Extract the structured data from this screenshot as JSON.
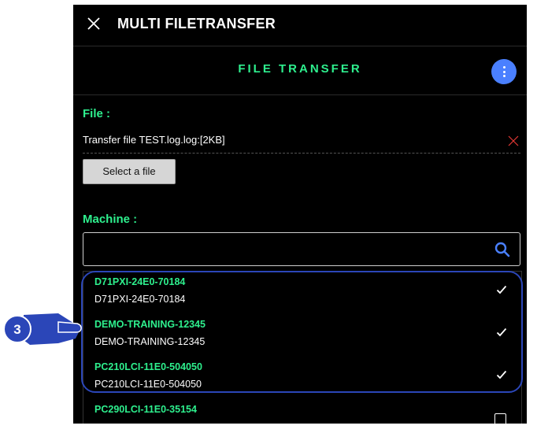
{
  "header": {
    "title": "MULTI FILETRANSFER"
  },
  "subheader": {
    "title": "FILE TRANSFER"
  },
  "file_section": {
    "label": "File :",
    "selected_file": "Transfer file TEST.log.log:[2KB]",
    "select_button_label": "Select a file"
  },
  "machine_section": {
    "label": "Machine :",
    "search_placeholder": "",
    "search_value": "",
    "items": [
      {
        "name": "D71PXI-24E0-70184",
        "subtitle": "D71PXI-24E0-70184",
        "checked": true
      },
      {
        "name": "DEMO-TRAINING-12345",
        "subtitle": "DEMO-TRAINING-12345",
        "checked": true
      },
      {
        "name": "PC210LCI-11E0-504050",
        "subtitle": "PC210LCI-11E0-504050",
        "checked": true
      },
      {
        "name": "PC290LCI-11E0-35154",
        "subtitle": "",
        "checked": false
      }
    ]
  },
  "annotation": {
    "step_number": "3"
  },
  "colors": {
    "accent_green": "#2ef08e",
    "menu_blue": "#4a80ff",
    "highlight_blue": "#2b46b8",
    "remove_red": "#e53935",
    "background": "#000000"
  },
  "icons": {
    "close": "close-icon",
    "menu": "kebab-menu-icon",
    "remove": "remove-icon",
    "search": "search-icon",
    "check": "check-icon",
    "pointer": "pointing-hand-icon"
  }
}
